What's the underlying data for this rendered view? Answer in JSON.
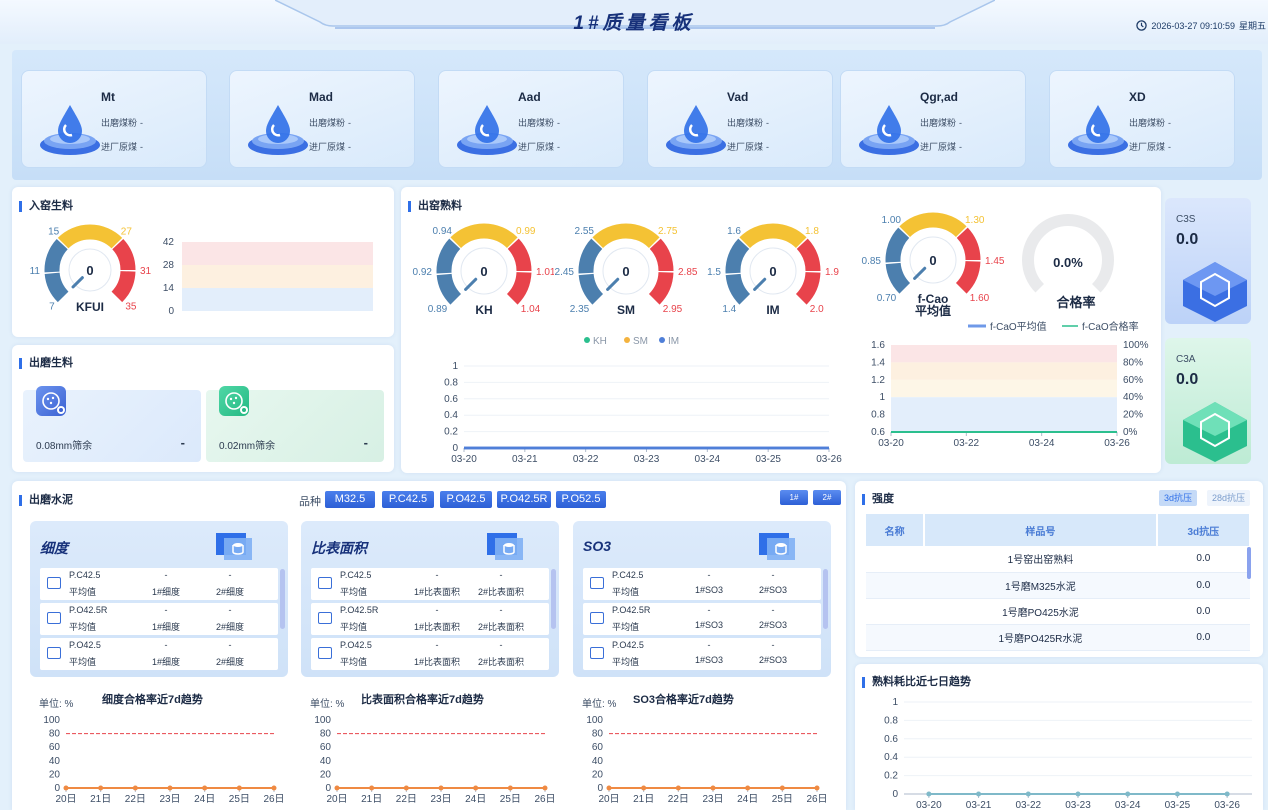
{
  "header": {
    "title": "1#质量看板",
    "datetime": "2026-03-27 09:10:59",
    "weekday": "星期五"
  },
  "kpis": [
    {
      "name": "Mt",
      "icon": "water-drop-icon",
      "row1_label": "出磨煤粉",
      "row1_value": "-",
      "row2_label": "进厂原煤",
      "row2_value": "-"
    },
    {
      "name": "Mad",
      "icon": "moisture-drop-icon",
      "row1_label": "出磨煤粉",
      "row1_value": "-",
      "row2_label": "进厂原煤",
      "row2_value": "-"
    },
    {
      "name": "Aad",
      "icon": "ash-particles-icon",
      "row1_label": "出磨煤粉",
      "row1_value": "-",
      "row2_label": "进厂原煤",
      "row2_value": "-"
    },
    {
      "name": "Vad",
      "icon": "volatile-arrows-icon",
      "row1_label": "出磨煤粉",
      "row1_value": "-",
      "row2_label": "进厂原煤",
      "row2_value": "-"
    },
    {
      "name": "Qgr,ad",
      "icon": "calorific-furnace-icon",
      "row1_label": "出磨煤粉",
      "row1_value": "-",
      "row2_label": "进厂原煤",
      "row2_value": "-"
    },
    {
      "name": "XD",
      "icon": "fineness-ruler-icon",
      "row1_label": "出磨煤粉",
      "row1_value": "-",
      "row2_label": "进厂原煤",
      "row2_value": "-"
    }
  ],
  "kiln_feed": {
    "title": "入窑生料",
    "gauge": {
      "name": "KFUI",
      "value": "0",
      "min": "7",
      "max": "35",
      "t1": "11",
      "t2": "15",
      "t3": "27",
      "t4": "31"
    },
    "band_chart": {
      "y_ticks": [
        "42",
        "28",
        "14",
        "0"
      ]
    }
  },
  "raw_meal_out": {
    "title": "出磨生料",
    "items": [
      {
        "label": "0.08mm筛余",
        "value": "-"
      },
      {
        "label": "0.02mm筛余",
        "value": "-"
      }
    ]
  },
  "clinker": {
    "title": "出窑熟料",
    "gauges": [
      {
        "name": "KH",
        "value": "0",
        "min": "0.89",
        "max": "1.04",
        "t1": "0.92",
        "t2": "0.94",
        "t3": "0.99",
        "t4": "1.01"
      },
      {
        "name": "SM",
        "value": "0",
        "min": "2.35",
        "max": "2.95",
        "t1": "2.45",
        "t2": "2.55",
        "t3": "2.75",
        "t4": "2.85"
      },
      {
        "name": "IM",
        "value": "0",
        "min": "1.4",
        "max": "2.0",
        "t1": "1.5",
        "t2": "1.6",
        "t3": "1.8",
        "t4": "1.9"
      }
    ],
    "fcao_gauge": {
      "name": "f-Cao",
      "name2": "平均值",
      "value": "0",
      "min": "0.70",
      "max": "1.60",
      "t1": "0.85",
      "t2": "1.00",
      "t3": "1.30",
      "t4": "1.45"
    },
    "pass_gauge": {
      "name": "合格率",
      "value": "0.0%"
    },
    "side": [
      {
        "name": "C3S",
        "value": "0.0"
      },
      {
        "name": "C3A",
        "value": "0.0"
      }
    ]
  },
  "cement": {
    "title": "出磨水泥",
    "kind_label": "品种",
    "kinds": [
      "M32.5",
      "P.C42.5",
      "P.O42.5",
      "P.O42.5R",
      "P.O52.5"
    ],
    "mills": [
      "1#",
      "2#"
    ],
    "panels": [
      {
        "title": "细度",
        "rows": [
          {
            "grade": "P.C42.5",
            "avg": "平均值",
            "v1": "-",
            "l1": "1#细度",
            "v2": "-",
            "l2": "2#细度"
          },
          {
            "grade": "P.O42.5R",
            "avg": "平均值",
            "v1": "-",
            "l1": "1#细度",
            "v2": "-",
            "l2": "2#细度"
          },
          {
            "grade": "P.O42.5",
            "avg": "平均值",
            "v1": "-",
            "l1": "1#细度",
            "v2": "-",
            "l2": "2#细度"
          }
        ],
        "trend_unit": "单位: %",
        "trend_title": "细度合格率近7d趋势"
      },
      {
        "title": "比表面积",
        "rows": [
          {
            "grade": "P.C42.5",
            "avg": "平均值",
            "v1": "-",
            "l1": "1#比表面积",
            "v2": "-",
            "l2": "2#比表面积"
          },
          {
            "grade": "P.O42.5R",
            "avg": "平均值",
            "v1": "-",
            "l1": "1#比表面积",
            "v2": "-",
            "l2": "2#比表面积"
          },
          {
            "grade": "P.O42.5",
            "avg": "平均值",
            "v1": "-",
            "l1": "1#比表面积",
            "v2": "-",
            "l2": "2#比表面积"
          }
        ],
        "trend_unit": "单位: %",
        "trend_title": "比表面积合格率近7d趋势"
      },
      {
        "title": "SO3",
        "rows": [
          {
            "grade": "P.C42.5",
            "avg": "平均值",
            "v1": "-",
            "l1": "1#SO3",
            "v2": "-",
            "l2": "2#SO3"
          },
          {
            "grade": "P.O42.5R",
            "avg": "平均值",
            "v1": "-",
            "l1": "1#SO3",
            "v2": "-",
            "l2": "2#SO3"
          },
          {
            "grade": "P.O42.5",
            "avg": "平均值",
            "v1": "-",
            "l1": "1#SO3",
            "v2": "-",
            "l2": "2#SO3"
          }
        ],
        "trend_unit": "单位: %",
        "trend_title": "SO3合格率近7d趋势"
      }
    ]
  },
  "strength": {
    "title": "强度",
    "tabs": [
      "3d抗压",
      "28d抗压"
    ],
    "headers": [
      "名称",
      "样品号",
      "3d抗压"
    ],
    "rows": [
      {
        "name": "",
        "sample": "1号窑出窑熟料",
        "value": "0.0"
      },
      {
        "name": "",
        "sample": "1号磨M325水泥",
        "value": "0.0"
      },
      {
        "name": "",
        "sample": "1号磨PO425水泥",
        "value": "0.0"
      },
      {
        "name": "",
        "sample": "1号磨PO425R水泥",
        "value": "0.0"
      }
    ]
  },
  "consumption": {
    "title": "熟料耗比近七日趋势"
  },
  "chart_data": [
    {
      "type": "line",
      "id": "ratio-trend",
      "title": "",
      "x": [
        "03-20",
        "03-21",
        "03-22",
        "03-23",
        "03-24",
        "03-25",
        "03-26"
      ],
      "series": [
        {
          "name": "KH",
          "values": [
            0,
            0,
            0,
            0,
            0,
            0,
            0
          ]
        },
        {
          "name": "SM",
          "values": [
            0,
            0,
            0,
            0,
            0,
            0,
            0
          ]
        },
        {
          "name": "IM",
          "values": [
            0,
            0,
            0,
            0,
            0,
            0,
            0
          ]
        }
      ],
      "ylim": [
        0,
        1
      ],
      "y_ticks": [
        "1",
        "0.8",
        "0.6",
        "0.4",
        "0.2",
        "0"
      ],
      "legend": "top",
      "colors": [
        "#2bbf8e",
        "#f4b33f",
        "#4f7fd8"
      ]
    },
    {
      "type": "line",
      "id": "fcao-trend",
      "title": "",
      "x": [
        "03-20",
        "03-22",
        "03-24",
        "03-26"
      ],
      "series": [
        {
          "name": "f-CaO平均值",
          "values": [
            0.6,
            0.6,
            0.6,
            0.6
          ]
        },
        {
          "name": "f-CaO合格率",
          "values": [
            0,
            0,
            0,
            0
          ]
        }
      ],
      "ylim": [
        0.6,
        1.6
      ],
      "y2lim": [
        0,
        100
      ],
      "y_ticks": [
        "1.6",
        "1.4",
        "1.2",
        "1",
        "0.8",
        "0.6"
      ],
      "y2_ticks": [
        "100%",
        "80%",
        "60%",
        "40%",
        "20%",
        "0%"
      ],
      "legend": "top-right"
    },
    {
      "type": "line",
      "id": "fineness-trend",
      "title": "细度合格率近7d趋势",
      "x": [
        "20日",
        "21日",
        "22日",
        "23日",
        "24日",
        "25日",
        "26日"
      ],
      "series": [
        {
          "values": [
            0,
            0,
            0,
            0,
            0,
            0,
            0
          ]
        }
      ],
      "target": 80,
      "ylim": [
        0,
        100
      ],
      "y_ticks": [
        "100",
        "80",
        "60",
        "40",
        "20",
        "0"
      ]
    },
    {
      "type": "line",
      "id": "surface-trend",
      "title": "比表面积合格率近7d趋势",
      "x": [
        "20日",
        "21日",
        "22日",
        "23日",
        "24日",
        "25日",
        "26日"
      ],
      "series": [
        {
          "values": [
            0,
            0,
            0,
            0,
            0,
            0,
            0
          ]
        }
      ],
      "target": 80,
      "ylim": [
        0,
        100
      ],
      "y_ticks": [
        "100",
        "80",
        "60",
        "40",
        "20",
        "0"
      ]
    },
    {
      "type": "line",
      "id": "so3-trend",
      "title": "SO3合格率近7d趋势",
      "x": [
        "20日",
        "21日",
        "22日",
        "23日",
        "24日",
        "25日",
        "26日"
      ],
      "series": [
        {
          "values": [
            0,
            0,
            0,
            0,
            0,
            0,
            0
          ]
        }
      ],
      "target": 80,
      "ylim": [
        0,
        100
      ],
      "y_ticks": [
        "100",
        "80",
        "60",
        "40",
        "20",
        "0"
      ]
    },
    {
      "type": "line",
      "id": "consumption-trend",
      "title": "熟料耗比近七日趋势",
      "x": [
        "03-20",
        "03-21",
        "03-22",
        "03-23",
        "03-24",
        "03-25",
        "03-26"
      ],
      "series": [
        {
          "values": [
            0,
            0,
            0,
            0,
            0,
            0,
            0
          ]
        }
      ],
      "ylim": [
        0,
        1
      ],
      "y_ticks": [
        "1",
        "0.8",
        "0.6",
        "0.4",
        "0.2",
        "0"
      ]
    }
  ],
  "colors": {
    "accent": "#2f6fe8",
    "danger": "#e8434b",
    "warn": "#f4c234",
    "steel": "#4c7fae",
    "green": "#2bbf8e"
  }
}
